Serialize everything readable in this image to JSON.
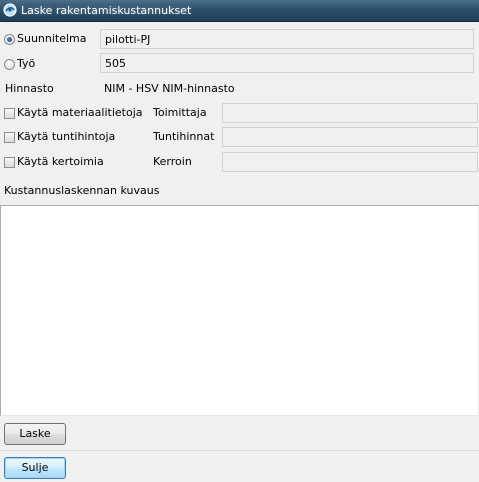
{
  "window": {
    "title": "Laske rakentamiskustannukset"
  },
  "suunnitelma": {
    "label": "Suunnitelma",
    "value": "pilotti-PJ",
    "selected": true
  },
  "tyo": {
    "label": "Työ",
    "value": "505",
    "selected": false
  },
  "hinnasto": {
    "label": "Hinnasto",
    "value": "NIM - HSV NIM-hinnasto"
  },
  "options": {
    "materiaali": {
      "label": "Käytä materiaalitietoja",
      "field_label": "Toimittaja",
      "value": ""
    },
    "tunti": {
      "label": "Käytä tuntihintoja",
      "field_label": "Tuntihinnat",
      "value": ""
    },
    "kerroin": {
      "label": "Käytä kertoimia",
      "field_label": "Kerroin",
      "value": ""
    }
  },
  "description": {
    "label": "Kustannuslaskennan kuvaus",
    "value": ""
  },
  "buttons": {
    "calculate": "Laske",
    "close": "Sulje"
  },
  "colors": {
    "titlebar": "#2c4f68",
    "focus_border": "#3c7fb1",
    "background": "#f0f0f0"
  }
}
